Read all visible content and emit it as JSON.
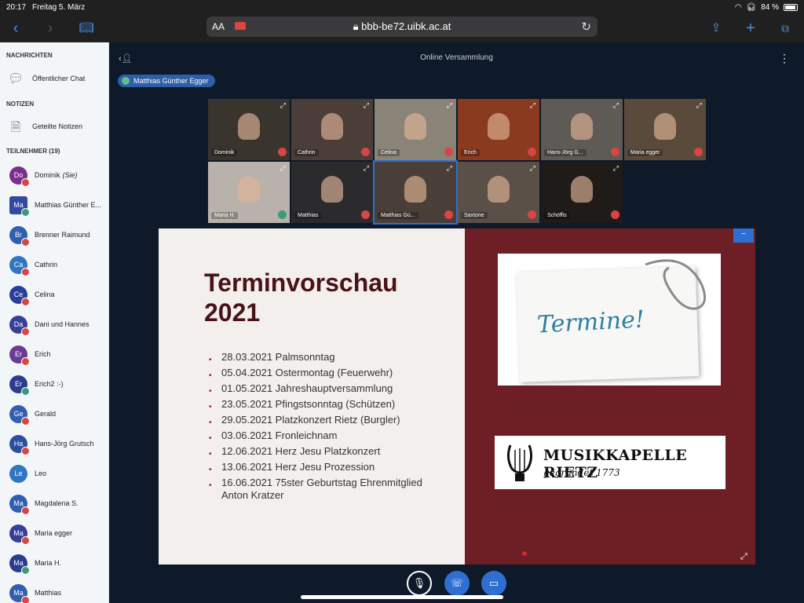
{
  "status": {
    "time": "20:17",
    "date": "Freitag 5. März",
    "battery": "84 %",
    "battery_level": 0.84
  },
  "browser": {
    "text_size": "AA",
    "url": "bbb-be72.uibk.ac.at"
  },
  "sidebar": {
    "messages_title": "NACHRICHTEN",
    "public_chat": "Öffentlicher Chat",
    "notes_title": "NOTIZEN",
    "shared_notes": "Geteilte Notizen",
    "participants_title": "TEILNEHMER (19)",
    "participants": [
      {
        "initials": "Do",
        "name": "Dominik",
        "you": "(Sie)",
        "color": "#7a2f8f",
        "mic": "muted",
        "square": false
      },
      {
        "initials": "Ma",
        "name": "Matthias Günther E...",
        "color": "#3449a1",
        "mic": "active",
        "square": true
      },
      {
        "initials": "Br",
        "name": "Brenner Raimund",
        "color": "#2f5fb0",
        "mic": "muted",
        "square": false
      },
      {
        "initials": "Ca",
        "name": "Cathrin",
        "color": "#2f76c2",
        "mic": "muted",
        "square": false
      },
      {
        "initials": "Ce",
        "name": "Celina",
        "color": "#283f9b",
        "mic": "muted",
        "square": false
      },
      {
        "initials": "Da",
        "name": "Dani und Hannes",
        "color": "#36409a",
        "mic": "muted",
        "square": false
      },
      {
        "initials": "Er",
        "name": "Erich",
        "color": "#6a3a96",
        "mic": "muted",
        "square": false
      },
      {
        "initials": "Er",
        "name": "Erich2 :-)",
        "color": "#2a3c8e",
        "mic": "active",
        "square": false
      },
      {
        "initials": "Ge",
        "name": "Gerald",
        "color": "#2f5fb0",
        "mic": "muted",
        "square": false
      },
      {
        "initials": "Ha",
        "name": "Hans-Jörg Grutsch",
        "color": "#2a4f9e",
        "mic": "muted",
        "square": false
      },
      {
        "initials": "Le",
        "name": "Leo",
        "color": "#2f76c2",
        "mic": "none",
        "square": false
      },
      {
        "initials": "Ma",
        "name": "Magdalena S.",
        "color": "#2f5fb0",
        "mic": "muted",
        "square": false
      },
      {
        "initials": "Ma",
        "name": "Maria egger",
        "color": "#36409a",
        "mic": "muted",
        "square": false
      },
      {
        "initials": "Ma",
        "name": "Maria H.",
        "color": "#2a3c8e",
        "mic": "active",
        "square": false
      },
      {
        "initials": "Ma",
        "name": "Matthias",
        "color": "#2f5fb0",
        "mic": "muted",
        "square": false
      }
    ]
  },
  "meeting": {
    "title": "Online Versammlung",
    "current_speaker": "Matthias Günther Egger",
    "videos": [
      {
        "name": "Dominik",
        "mic": "muted",
        "bg": "#3a342f",
        "active": false
      },
      {
        "name": "Cathrin",
        "mic": "muted",
        "bg": "#4b3d38",
        "active": false
      },
      {
        "name": "Celina",
        "mic": "muted",
        "bg": "#8a8378",
        "active": false
      },
      {
        "name": "Erich",
        "mic": "muted",
        "bg": "#8a3a1f",
        "active": false
      },
      {
        "name": "Hans-Jörg G...",
        "mic": "muted",
        "bg": "#5e5a55",
        "active": false
      },
      {
        "name": "Maria egger",
        "mic": "muted",
        "bg": "#5a4a3c",
        "active": false
      },
      {
        "name": "Maria H.",
        "mic": "active",
        "bg": "#b8b2aa",
        "active": false
      },
      {
        "name": "Matthias",
        "mic": "muted",
        "bg": "#2b2b2e",
        "active": false
      },
      {
        "name": "Matthias Gü...",
        "mic": "muted",
        "bg": "#4a3f38",
        "active": true
      },
      {
        "name": "Saxtone",
        "mic": "muted",
        "bg": "#5a5048",
        "active": false
      },
      {
        "name": "Schöffis",
        "mic": "muted",
        "bg": "#1e1b18",
        "active": false
      }
    ]
  },
  "slide": {
    "title_line1": "Terminvorschau",
    "title_line2": "2021",
    "items": [
      "28.03.2021 Palmsonntag",
      "05.04.2021 Ostermontag (Feuerwehr)",
      "01.05.2021 Jahreshauptversammlung",
      "23.05.2021 Pfingstsonntag (Schützen)",
      "29.05.2021 Platzkonzert Rietz (Burgler)",
      "03.06.2021 Fronleichnam",
      "12.06.2021 Herz Jesu Platzkonzert",
      "13.06.2021 Herz Jesu Prozession",
      "16.06.2021 75ster Geburtstag Ehrenmitglied Anton Kratzer"
    ],
    "card_word": "Termine!",
    "logo_line1": "MUSIKKAPELLE RIETZ",
    "logo_line2": "gegründet 1773"
  },
  "colors": {
    "accent": "#2f6fd1",
    "slide_dark": "#6e1f25",
    "muted_red": "#d84545"
  }
}
